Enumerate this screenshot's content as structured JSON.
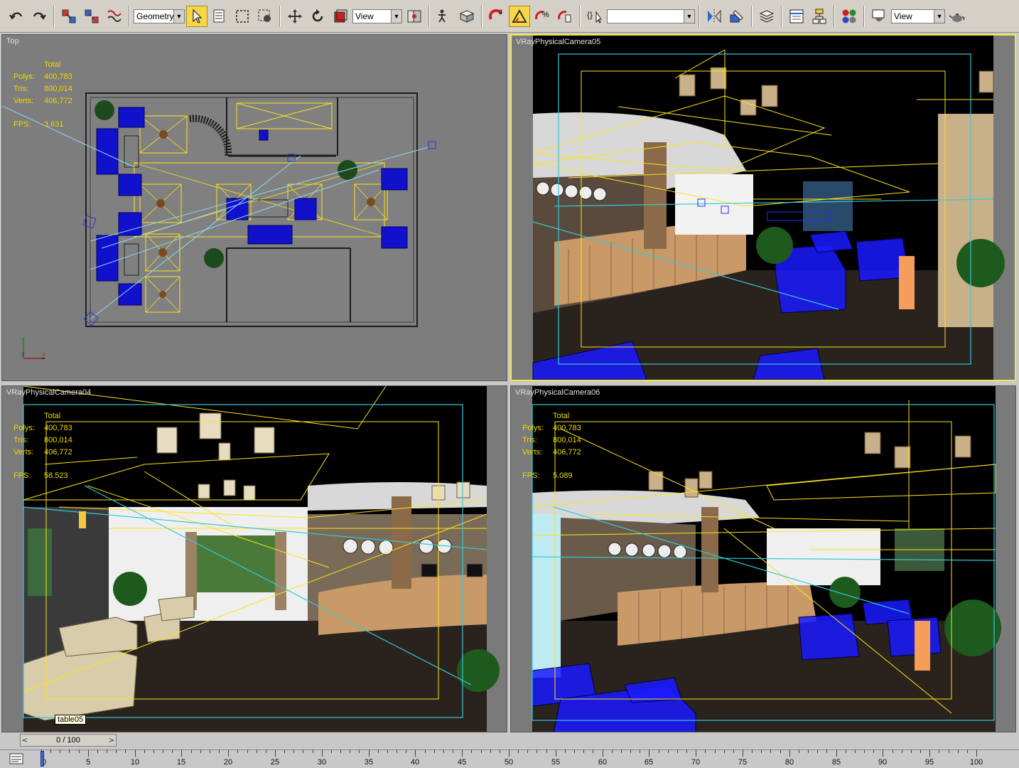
{
  "toolbar": {
    "selection_filter": "Geometry",
    "ref_coord_1": "View",
    "named_selection": "",
    "ref_coord_2": "View",
    "snap_angle_label": "3",
    "snap_percent_label": "%"
  },
  "viewports": {
    "top": {
      "label": "Top",
      "stats": {
        "header": "Total",
        "polys_label": "Polys:",
        "polys": "400,783",
        "tris_label": "Tris:",
        "tris": "800,014",
        "verts_label": "Verts:",
        "verts": "406,772",
        "fps_label": "FPS:",
        "fps": "3.631"
      },
      "axis": {
        "y": "y",
        "z": "z",
        "x": "x"
      }
    },
    "cam05": {
      "label": "VRayPhysicalCamera05"
    },
    "cam04": {
      "label": "VRayPhysicalCamera04",
      "stats": {
        "header": "Total",
        "polys_label": "Polys:",
        "polys": "400,783",
        "tris_label": "Tris:",
        "tris": "800,014",
        "verts_label": "Verts:",
        "verts": "406,772",
        "fps_label": "FPS:",
        "fps": "58.523"
      },
      "tooltip": "table05"
    },
    "cam06": {
      "label": "VRayPhysicalCamera06",
      "stats": {
        "header": "Total",
        "polys_label": "Polys:",
        "polys": "400,783",
        "tris_label": "Tris:",
        "tris": "800,014",
        "verts_label": "Verts:",
        "verts": "406,772",
        "fps_label": "FPS:",
        "fps": "5.089"
      }
    }
  },
  "timeline": {
    "slider_value": "0 / 100",
    "prev": "<",
    "next": ">",
    "ticks": [
      "0",
      "5",
      "10",
      "15",
      "20",
      "25",
      "30",
      "35",
      "40",
      "45",
      "50",
      "55",
      "60",
      "65",
      "70",
      "75",
      "80",
      "85",
      "90",
      "95",
      "100"
    ]
  },
  "colors": {
    "accent_yellow": "#f4e64a",
    "stats_yellow": "#f0d800",
    "wire_blue": "#1a1aff",
    "helper_yellow": "#ffe21a",
    "camera_cyan": "#35c9d9"
  }
}
